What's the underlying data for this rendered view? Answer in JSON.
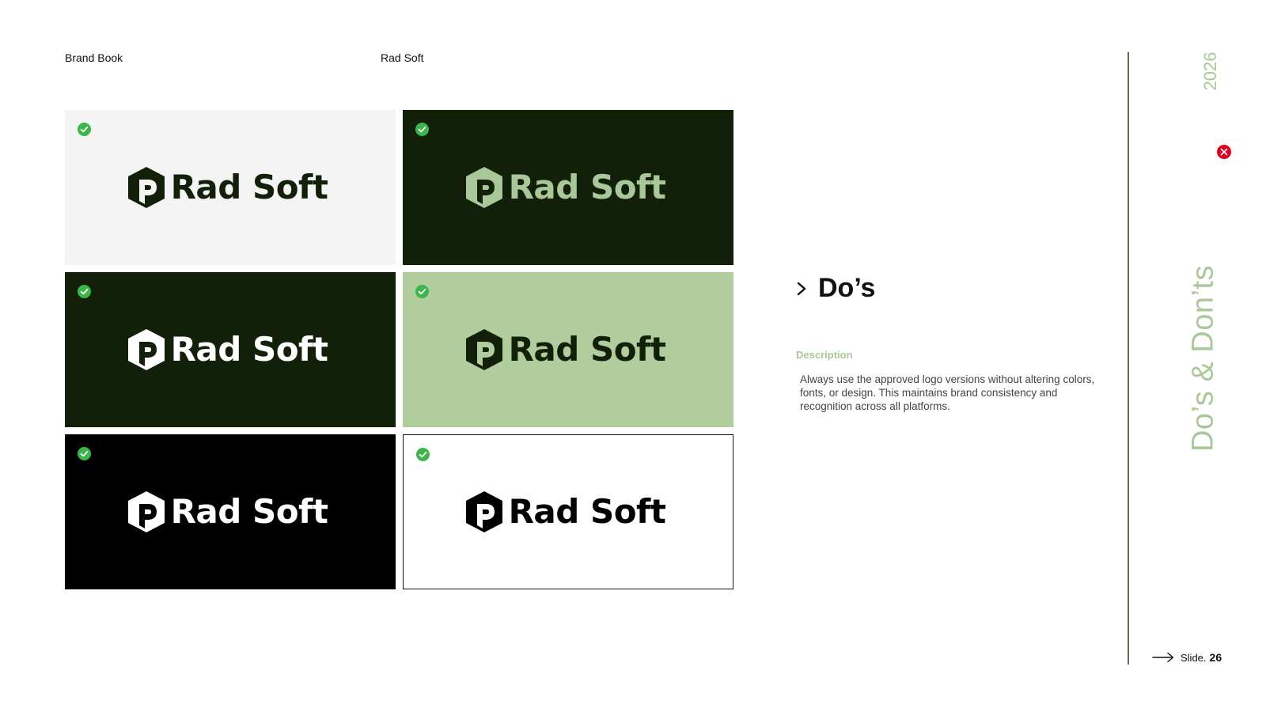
{
  "header": {
    "left": "Brand Book",
    "center": "Rad Soft"
  },
  "logo": {
    "wordmark": "Rad Soft"
  },
  "tiles": [
    {
      "variant": "on-light-gray",
      "background": "#f4f4f4",
      "logo_color": "#12200a",
      "status": "check-icon"
    },
    {
      "variant": "on-dark-green",
      "background": "#12200a",
      "logo_color": "#a9c89a",
      "status": "check-icon"
    },
    {
      "variant": "white-on-dark-green",
      "background": "#12200a",
      "logo_color": "#ffffff",
      "status": "check-icon"
    },
    {
      "variant": "on-light-green",
      "background": "#b1cc9d",
      "logo_color": "#12200a",
      "status": "check-icon"
    },
    {
      "variant": "white-on-black",
      "background": "#000000",
      "logo_color": "#ffffff",
      "status": "check-icon"
    },
    {
      "variant": "black-on-white-outlined",
      "background": "#ffffff",
      "logo_color": "#000000",
      "status": "check-icon"
    }
  ],
  "content": {
    "title": "Do’s",
    "description_label": "Description",
    "description": "Always use the approved logo versions without altering colors, fonts, or design. This maintains brand consistency and recognition across all platforms."
  },
  "sidebar": {
    "year": "2026",
    "section_label": "Do’s & Don’ts",
    "status_icon": "x-circle-icon"
  },
  "footer": {
    "slide_label": "Slide.",
    "slide_number": "26"
  },
  "colors": {
    "accent_green": "#a9c89a",
    "dark_green": "#12200a",
    "check_green": "#3cb54a",
    "dont_red": "#e0001b",
    "divider": "#5e6e55"
  }
}
